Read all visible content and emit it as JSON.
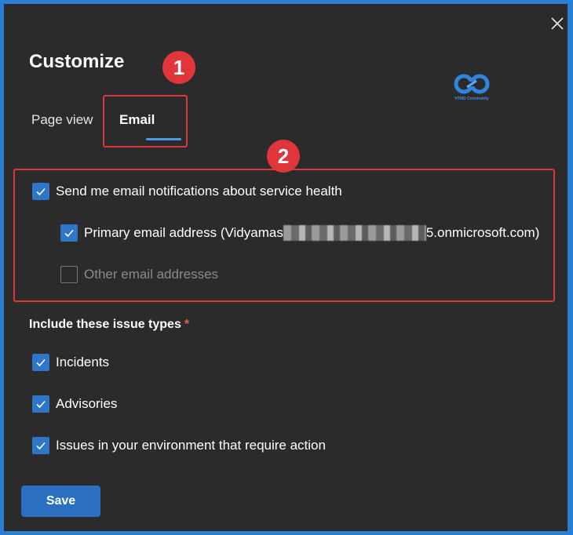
{
  "dialog": {
    "title": "Customize",
    "close_icon": "close-icon"
  },
  "tabs": [
    {
      "label": "Page view",
      "active": false
    },
    {
      "label": "Email",
      "active": true
    }
  ],
  "callouts": {
    "one": "1",
    "two": "2"
  },
  "logo": {
    "text": "HTMD Community"
  },
  "notifications": {
    "send_email": {
      "label": "Send me email notifications about service health",
      "checked": true
    },
    "primary_email": {
      "label_prefix": "Primary email address (Vidyamas",
      "label_suffix": "5.onmicrosoft.com)",
      "checked": true
    },
    "other_email": {
      "label": "Other email addresses",
      "checked": false
    }
  },
  "issue_types": {
    "label": "Include these issue types",
    "required_marker": "*",
    "items": [
      {
        "label": "Incidents",
        "checked": true
      },
      {
        "label": "Advisories",
        "checked": true
      },
      {
        "label": "Issues in your environment that require action",
        "checked": true
      }
    ]
  },
  "footer": {
    "save_label": "Save"
  },
  "colors": {
    "accent": "#2e76c7",
    "annotation_red": "#e0353a",
    "panel_bg": "#2b2b2b",
    "frame_blue": "#2a7fd4"
  }
}
